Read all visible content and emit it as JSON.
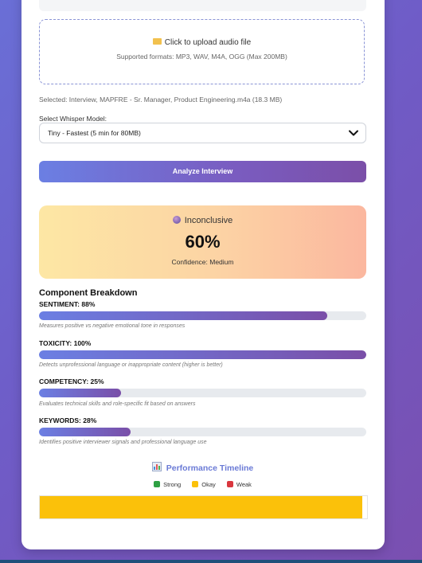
{
  "upload": {
    "prompt": "Click to upload audio file",
    "formats": "Supported formats: MP3, WAV, M4A, OGG (Max 200MB)"
  },
  "selected_file": "Selected: Interview, MAPFRE - Sr. Manager, Product Engineering.m4a (18.3 MB)",
  "model": {
    "label": "Select Whisper Model:",
    "value": "Tiny - Fastest (5 min for 80MB)"
  },
  "analyze_label": "Analyze Interview",
  "result": {
    "verdict": "Inconclusive",
    "score": "60%",
    "confidence": "Confidence: Medium"
  },
  "breakdown": {
    "title": "Component Breakdown",
    "metrics": [
      {
        "label": "SENTIMENT: 88%",
        "value": 0.88,
        "desc": "Measures positive vs negative emotional tone in responses"
      },
      {
        "label": "TOXICITY: 100%",
        "value": 1.0,
        "desc": "Detects unprofessional language or inappropriate content (higher is better)"
      },
      {
        "label": "COMPETENCY: 25%",
        "value": 0.25,
        "desc": "Evaluates technical skills and role-specific fit based on answers"
      },
      {
        "label": "KEYWORDS: 28%",
        "value": 0.28,
        "desc": "Identifies positive interviewer signals and professional language use"
      }
    ]
  },
  "timeline": {
    "title": "Performance Timeline",
    "legend": [
      {
        "label": "Strong",
        "color": "#2ea043"
      },
      {
        "label": "Okay",
        "color": "#fbc10a"
      },
      {
        "label": "Weak",
        "color": "#d9363e"
      }
    ],
    "segments": [
      {
        "status": "Okay",
        "fraction": 0.985,
        "color": "#fbc10a"
      }
    ]
  }
}
